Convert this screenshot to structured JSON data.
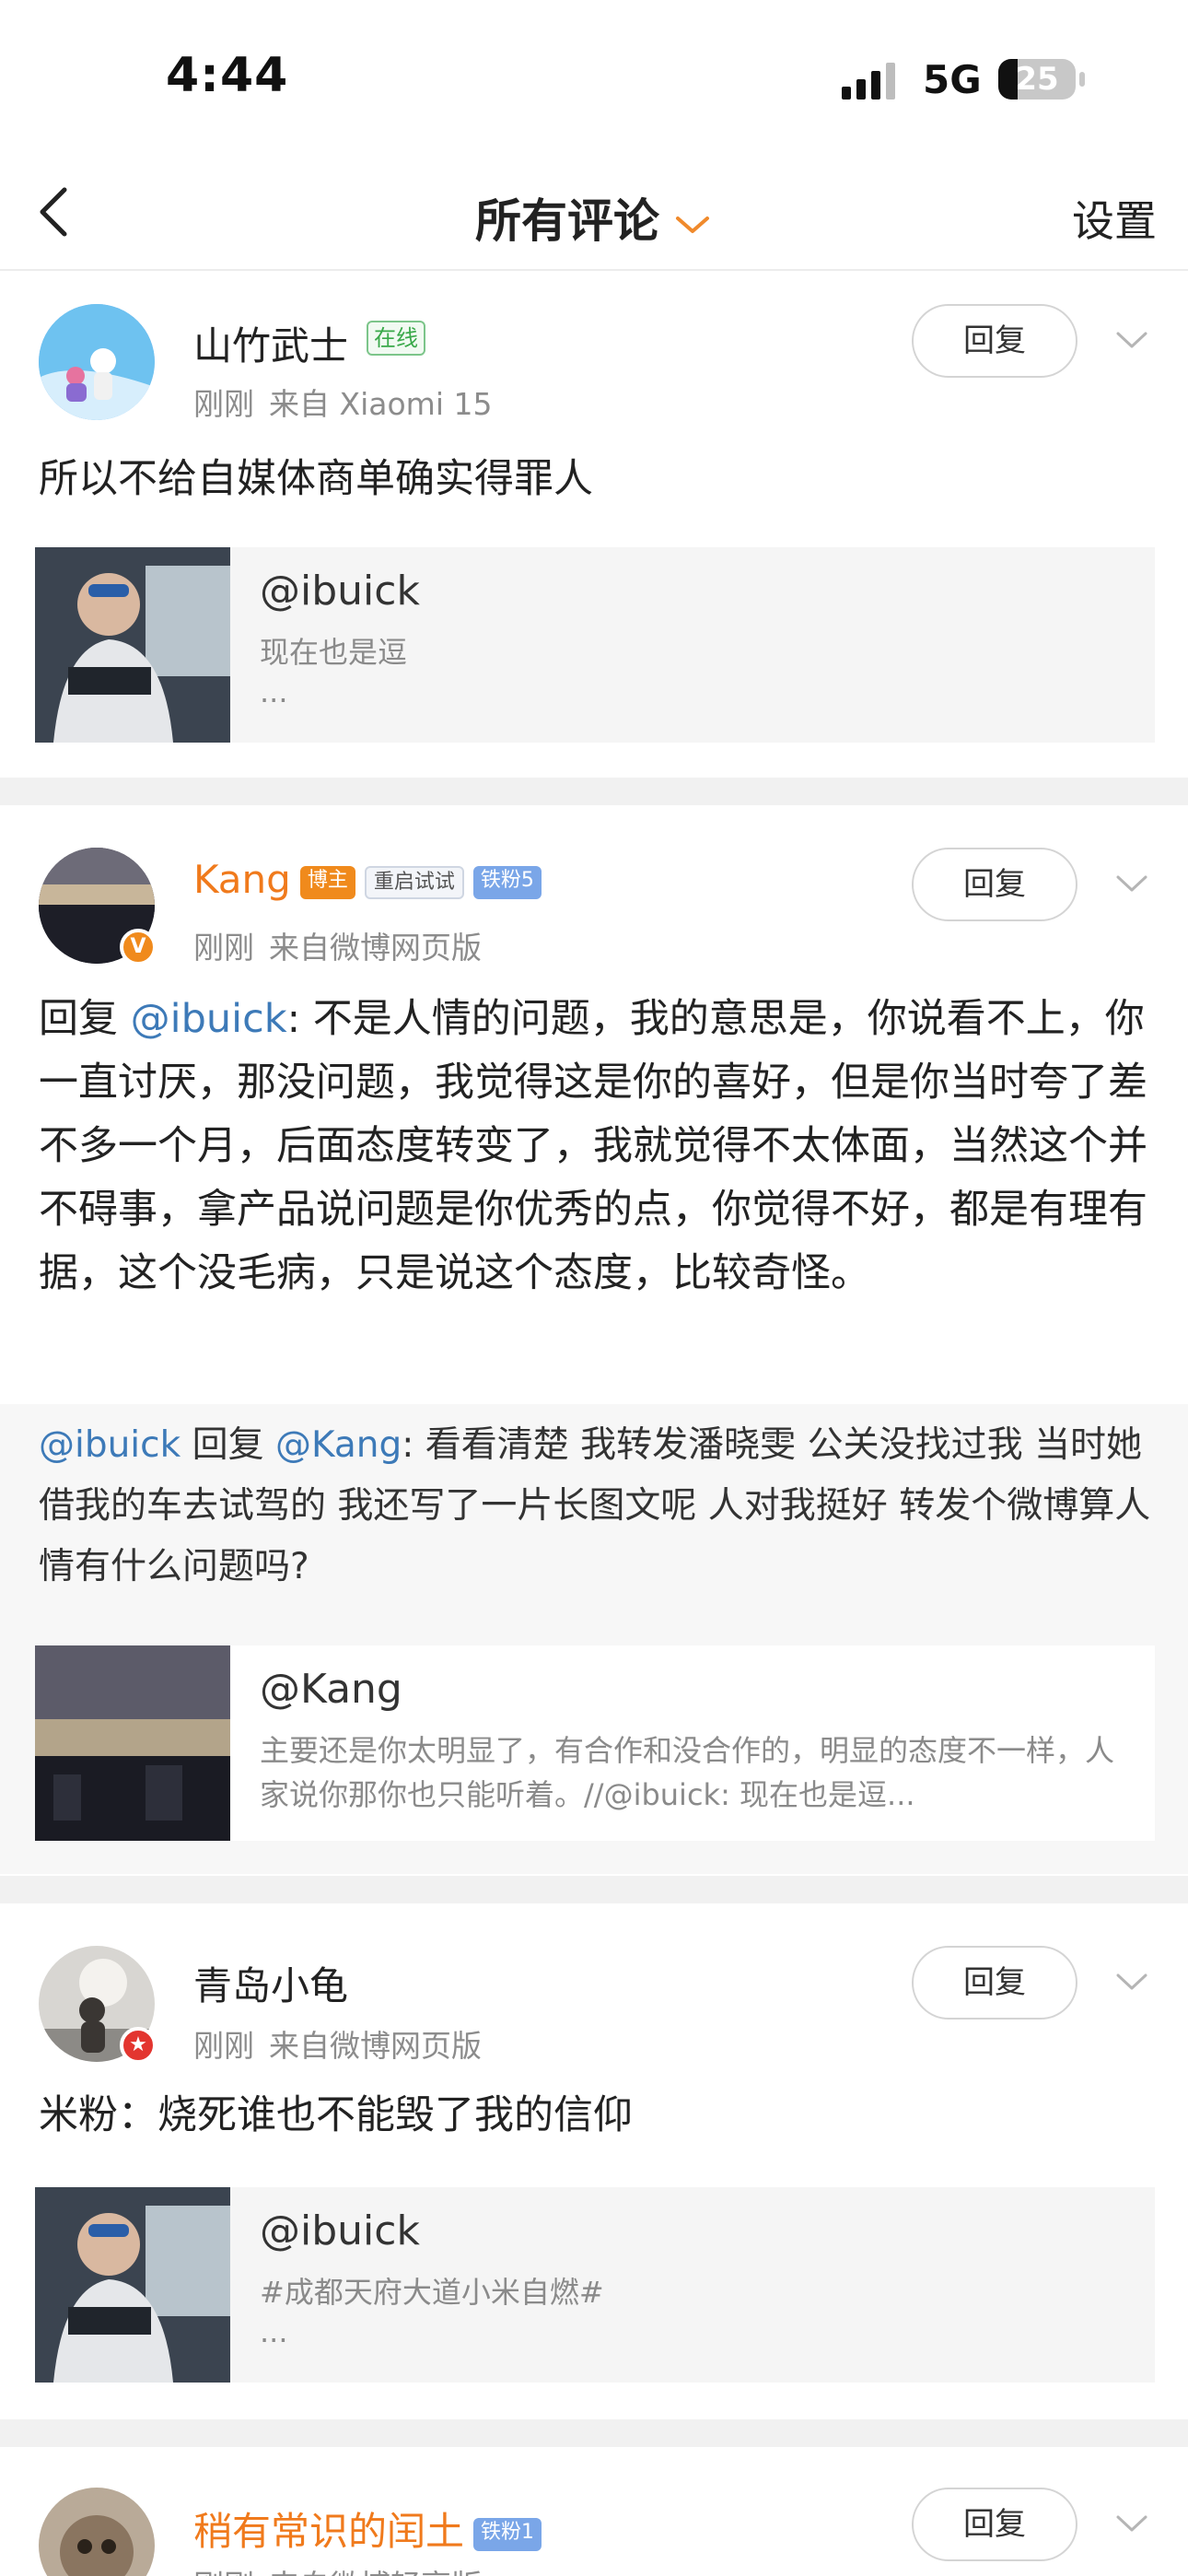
{
  "status_bar": {
    "time": "4:44",
    "network": "5G",
    "battery": "25",
    "battery_level": 0.25
  },
  "nav": {
    "title": "所有评论",
    "settings": "设置"
  },
  "colors": {
    "orange_name": "#f07a1c",
    "link": "#3d7ab8",
    "online_green": "#3aa94a"
  },
  "comments": [
    {
      "name": "山竹武士",
      "online_tag": "在线",
      "time": "刚刚",
      "source": "来自 Xiaomi 15",
      "reply_label": "回复",
      "text": "所以不给自媒体商单确实得罪人",
      "quote": {
        "name": "@ibuick",
        "text": "现在也是逗",
        "ellipsis": "..."
      }
    },
    {
      "name": "Kang",
      "badges": [
        "博主",
        "重启试试",
        "铁粉5"
      ],
      "time": "刚刚",
      "source": "来自微博网页版",
      "reply_label": "回复",
      "reply_prefix": "回复 ",
      "reply_target": "@ibuick",
      "text": ": 不是人情的问题，我的意思是，你说看不上，你一直讨厌，那没问题，我觉得这是你的喜好，但是你当时夸了差不多一个月，后面态度转变了，我就觉得不太体面，当然这个并不碍事，拿产品说问题是你优秀的点，你觉得不好，都是有理有据，这个没毛病，只是说这个态度，比较奇怪。",
      "nested": {
        "author": "@ibuick",
        "reply_word": " 回复 ",
        "target": "@Kang",
        "text": ": 看看清楚 我转发潘晓雯 公关没找过我 当时她借我的车去试驾的 我还写了一片长图文呢 人对我挺好 转发个微博算人情有什么问题吗?",
        "quote": {
          "name": "@Kang",
          "text": "主要还是你太明显了，有合作和没合作的，明显的态度不一样，人家说你那你也只能听着。//@ibuick: 现在也是逗..."
        }
      }
    },
    {
      "name": "青岛小龟",
      "time": "刚刚",
      "source": "来自微博网页版",
      "reply_label": "回复",
      "text": "米粉：烧死谁也不能毁了我的信仰",
      "quote": {
        "name": "@ibuick",
        "text": "#成都天府大道小米自燃#",
        "ellipsis": "..."
      }
    },
    {
      "name": "稍有常识的闰土",
      "badges": [
        "铁粉1"
      ],
      "time": "刚刚",
      "source": "来自微博轻享版",
      "reply_label": "回复"
    }
  ]
}
